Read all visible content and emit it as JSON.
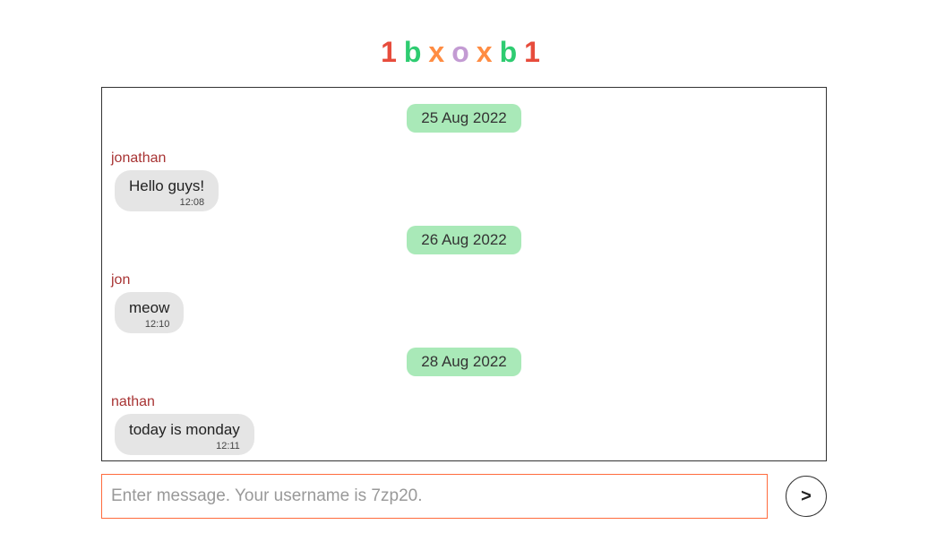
{
  "logo": {
    "chars": [
      {
        "text": "1",
        "color": "#e74c3c"
      },
      {
        "text": "b",
        "color": "#2ecc71"
      },
      {
        "text": "x",
        "color": "#ff8c42"
      },
      {
        "text": "o",
        "color": "#c39bd3"
      },
      {
        "text": "x",
        "color": "#ff8c42"
      },
      {
        "text": "b",
        "color": "#2ecc71"
      },
      {
        "text": "1",
        "color": "#e74c3c"
      }
    ]
  },
  "messages": [
    {
      "type": "date",
      "text": "25 Aug 2022"
    },
    {
      "type": "msg",
      "username": "jonathan",
      "text": "Hello guys!",
      "time": "12:08"
    },
    {
      "type": "date",
      "text": "26 Aug 2022"
    },
    {
      "type": "msg",
      "username": "jon",
      "text": "meow",
      "time": "12:10"
    },
    {
      "type": "date",
      "text": "28 Aug 2022"
    },
    {
      "type": "msg",
      "username": "nathan",
      "text": "today is monday",
      "time": "12:11"
    }
  ],
  "input": {
    "placeholder": "Enter message. Your username is 7zp20."
  },
  "send_label": ">"
}
